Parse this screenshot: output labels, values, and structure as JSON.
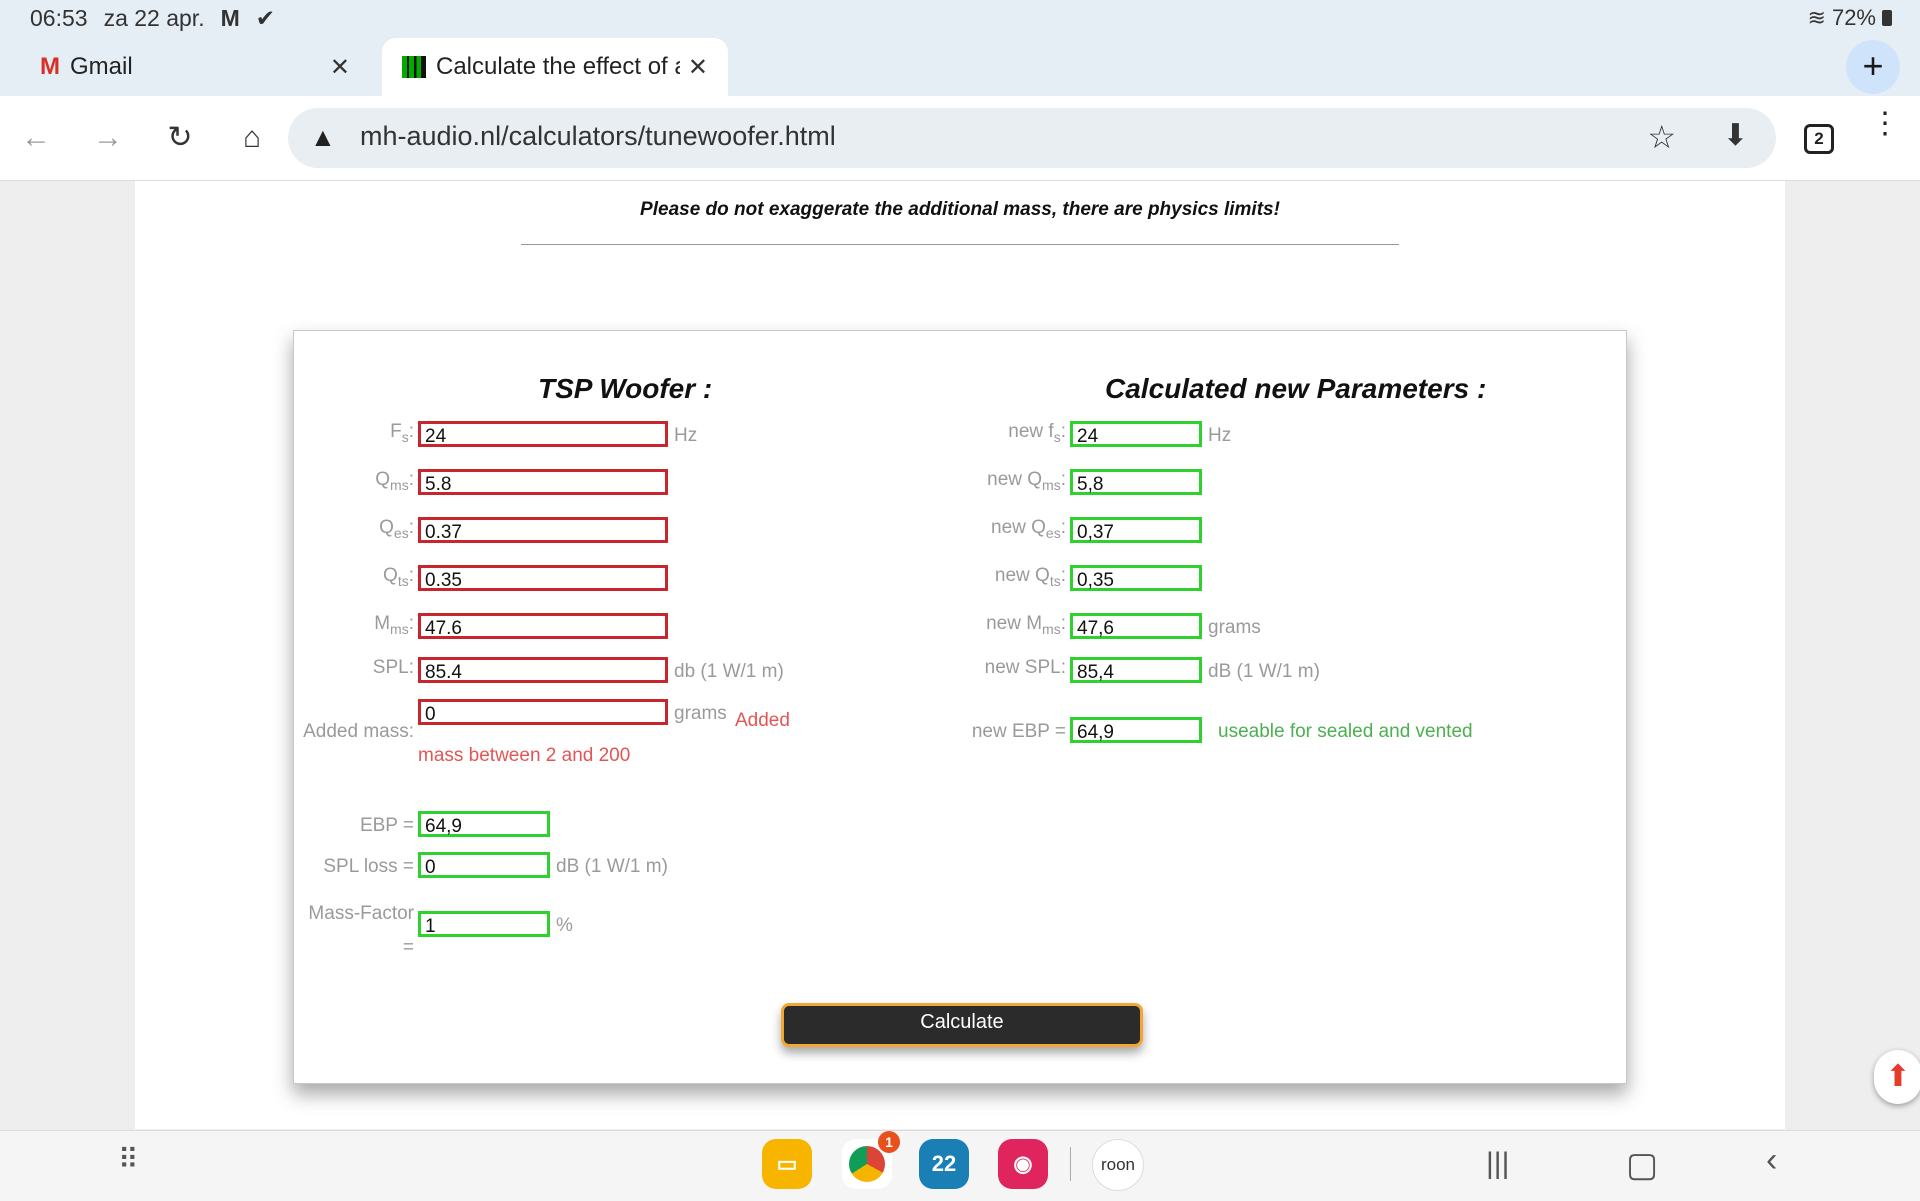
{
  "status_bar": {
    "time": "06:53",
    "date": "za 22 apr.",
    "battery": "72%"
  },
  "tabs": [
    {
      "title": "Gmail",
      "close": "✕"
    },
    {
      "title": "Calculate the effect of added mass",
      "close": "✕"
    }
  ],
  "toolbar": {
    "url": "mh-audio.nl/calculators/tunewoofer.html",
    "tab_count": "2"
  },
  "page": {
    "notice": "Please do not exaggerate the additional mass, there are physics limits!",
    "left": {
      "title": "TSP Woofer :",
      "fields": {
        "fs": {
          "value": "24",
          "unit": "Hz"
        },
        "qms": {
          "value": "5.8"
        },
        "qes": {
          "value": "0.37"
        },
        "qts": {
          "value": "0.35"
        },
        "mms": {
          "value": "47.6"
        },
        "spl": {
          "label": "SPL:",
          "value": "85.4",
          "unit": "db (1 W/1 m)"
        },
        "added_mass": {
          "label": "Added mass:",
          "value": "0",
          "unit": "grams",
          "hint": "Added mass between 2 and 200"
        }
      },
      "results": {
        "ebp": {
          "label": "EBP =",
          "value": "64,9"
        },
        "spl_loss": {
          "label": "SPL loss =",
          "value": "0",
          "unit": "dB (1 W/1 m)"
        },
        "mass_factor": {
          "label": "Mass-Factor =",
          "value": "1",
          "unit": "%"
        }
      }
    },
    "right": {
      "title": "Calculated new Parameters :",
      "fields": {
        "fs": {
          "prefix": "new f",
          "value": "24",
          "unit": "Hz"
        },
        "qms": {
          "prefix": "new Q",
          "value": "5,8"
        },
        "qes": {
          "prefix": "new Q",
          "value": "0,37"
        },
        "qts": {
          "prefix": "new Q",
          "value": "0,35"
        },
        "mms": {
          "prefix": "new M",
          "value": "47,6",
          "unit": "grams"
        },
        "spl": {
          "label": "new SPL:",
          "value": "85,4",
          "unit": "dB (1 W/1 m)"
        },
        "ebp": {
          "label": "new EBP =",
          "value": "64,9",
          "note": "useable for sealed and vented"
        }
      }
    },
    "calculate_label": "Calculate"
  },
  "dock": {
    "calendar_day": "22",
    "chrome_badge": "1",
    "roon_label": "roon"
  }
}
